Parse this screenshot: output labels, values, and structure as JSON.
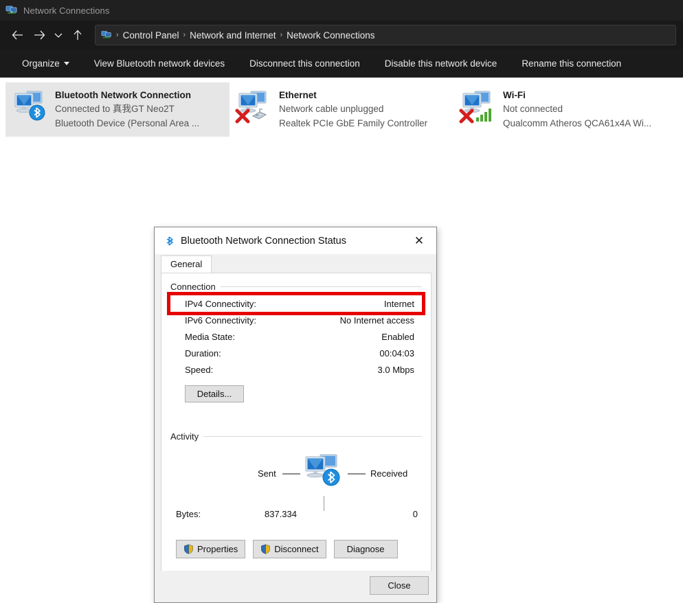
{
  "window": {
    "title": "Network Connections",
    "title_icon": "network-connections-icon"
  },
  "nav": {
    "back_icon": "arrow-left-icon",
    "forward_icon": "arrow-right-icon",
    "recent_icon": "chevron-down-icon",
    "up_icon": "arrow-up-icon",
    "breadcrumb_icon": "network-connections-icon",
    "breadcrumb": [
      {
        "label": "Control Panel"
      },
      {
        "label": "Network and Internet"
      },
      {
        "label": "Network Connections"
      }
    ],
    "separator": "›"
  },
  "toolbar": {
    "items": [
      {
        "label": "Organize",
        "has_caret": true
      },
      {
        "label": "View Bluetooth network devices",
        "has_caret": false
      },
      {
        "label": "Disconnect this connection",
        "has_caret": false
      },
      {
        "label": "Disable this network device",
        "has_caret": false
      },
      {
        "label": "Rename this connection",
        "has_caret": false
      }
    ]
  },
  "adapters": [
    {
      "name": "Bluetooth Network Connection",
      "status": "Connected to 真我GT Neo2T",
      "device": "Bluetooth Device (Personal Area ...",
      "selected": true,
      "badge": "bluetooth-badge-icon"
    },
    {
      "name": "Ethernet",
      "status": "Network cable unplugged",
      "device": "Realtek PCIe GbE Family Controller",
      "selected": false,
      "badge": "red-x-cable-badge-icon"
    },
    {
      "name": "Wi-Fi",
      "status": "Not connected",
      "device": "Qualcomm Atheros QCA61x4A Wi...",
      "selected": false,
      "badge": "red-x-signal-badge-icon"
    }
  ],
  "dialog": {
    "title": "Bluetooth Network Connection Status",
    "title_icon": "bluetooth-icon",
    "close_icon": "✕",
    "tabs": [
      {
        "label": "General",
        "active": true
      }
    ],
    "connection": {
      "group_label": "Connection",
      "rows": [
        {
          "key": "IPv4 Connectivity:",
          "value": "Internet",
          "highlighted": true
        },
        {
          "key": "IPv6 Connectivity:",
          "value": "No Internet access",
          "highlighted": false
        },
        {
          "key": "Media State:",
          "value": "Enabled",
          "highlighted": false
        },
        {
          "key": "Duration:",
          "value": "00:04:03",
          "highlighted": false
        },
        {
          "key": "Speed:",
          "value": "3.0 Mbps",
          "highlighted": false
        }
      ],
      "details_button": "Details..."
    },
    "activity": {
      "group_label": "Activity",
      "sent_label": "Sent",
      "received_label": "Received",
      "icon": "bluetooth-network-icon",
      "bytes_label": "Bytes:",
      "bytes_sent": "837.334",
      "bytes_received": "0"
    },
    "buttons": {
      "properties": "Properties",
      "disconnect": "Disconnect",
      "diagnose": "Diagnose",
      "close": "Close",
      "shield_icon": "uac-shield-icon"
    }
  },
  "colors": {
    "highlight_red": "#e60000",
    "titlebar_bg": "#202020",
    "navbar_bg": "#191919",
    "toolbar_bg": "#1b1b1b",
    "selection_bg": "#e6e6e6",
    "dialog_bg": "#f0f0f0"
  }
}
